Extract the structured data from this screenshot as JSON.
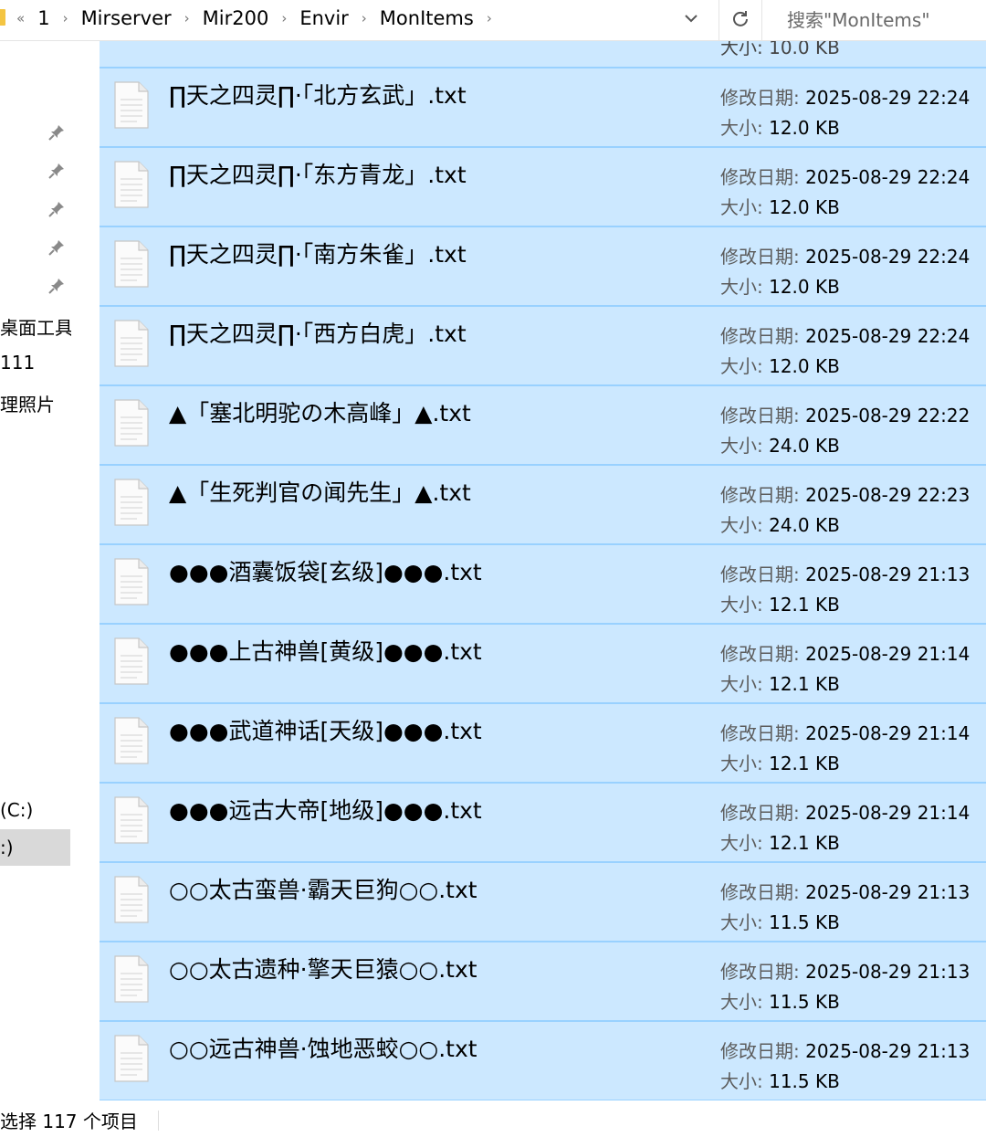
{
  "address_bar": {
    "lead": "«",
    "crumbs": [
      "1",
      "Mirserver",
      "Mir200",
      "Envir",
      "MonItems"
    ],
    "separator": "›",
    "search_placeholder": "搜索\"MonItems\""
  },
  "nav": {
    "labels": [
      "桌面工具",
      "111",
      "理照片",
      "(C:)",
      ":)"
    ]
  },
  "partial_row_text": "大小: 10.0 KB",
  "meta_labels": {
    "date": "修改日期:",
    "size": "大小:"
  },
  "files": [
    {
      "name": "∏天之四灵∏·「北方玄武」.txt",
      "date": "2025-08-29 22:24",
      "size": "12.0 KB"
    },
    {
      "name": "∏天之四灵∏·「东方青龙」.txt",
      "date": "2025-08-29 22:24",
      "size": "12.0 KB"
    },
    {
      "name": "∏天之四灵∏·「南方朱雀」.txt",
      "date": "2025-08-29 22:24",
      "size": "12.0 KB"
    },
    {
      "name": "∏天之四灵∏·「西方白虎」.txt",
      "date": "2025-08-29 22:24",
      "size": "12.0 KB"
    },
    {
      "name": "▲「塞北明驼の木高峰」▲.txt",
      "date": "2025-08-29 22:22",
      "size": "24.0 KB"
    },
    {
      "name": "▲「生死判官の闻先生」▲.txt",
      "date": "2025-08-29 22:23",
      "size": "24.0 KB"
    },
    {
      "name": "●●●酒囊饭袋[玄级]●●●.txt",
      "date": "2025-08-29 21:13",
      "size": "12.1 KB"
    },
    {
      "name": "●●●上古神兽[黄级]●●●.txt",
      "date": "2025-08-29 21:14",
      "size": "12.1 KB"
    },
    {
      "name": "●●●武道神话[天级]●●●.txt",
      "date": "2025-08-29 21:14",
      "size": "12.1 KB"
    },
    {
      "name": "●●●远古大帝[地级]●●●.txt",
      "date": "2025-08-29 21:14",
      "size": "12.1 KB"
    },
    {
      "name": "○○太古蛮兽·霸天巨狗○○.txt",
      "date": "2025-08-29 21:13",
      "size": "11.5 KB"
    },
    {
      "name": "○○太古遗种·擎天巨猿○○.txt",
      "date": "2025-08-29 21:13",
      "size": "11.5 KB"
    },
    {
      "name": "○○远古神兽·蚀地恶蛟○○.txt",
      "date": "2025-08-29 21:13",
      "size": "11.5 KB"
    }
  ],
  "status": {
    "text": "选择 117 个项目"
  }
}
